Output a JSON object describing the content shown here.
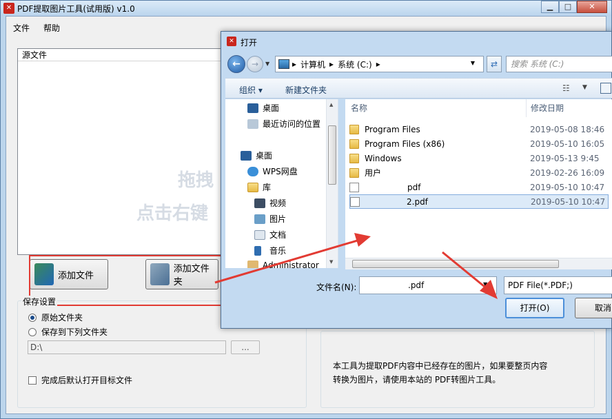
{
  "app": {
    "title": "PDF提取图片工具(试用版) v1.0",
    "icon": "app-logo-icon"
  },
  "menu": {
    "file": "文件",
    "help": "帮助"
  },
  "source_list": {
    "header": "源文件",
    "watermark_line1": "拖拽",
    "watermark_line2": "点击右键"
  },
  "buttons": {
    "add_file": "添加文件",
    "add_folder": "添加文件夹"
  },
  "save_settings": {
    "legend": "保存设置",
    "option_original": "原始文件夹",
    "option_custom": "保存到下列文件夹",
    "path": "D:\\",
    "browse": "...",
    "open_after": "完成后默认打开目标文件"
  },
  "info": {
    "line1": "本工具为提取PDF内容中已经存在的图片，如果要整页内容",
    "line2": "转换为图片，请使用本站的 PDF转图片工具。"
  },
  "dialog": {
    "title": "打开",
    "breadcrumb": [
      "计算机",
      "系统 (C:)"
    ],
    "search_placeholder": "搜索 系统 (C:)",
    "toolbar": {
      "organize": "组织 ▾",
      "new_folder": "新建文件夹"
    },
    "nav": [
      "桌面",
      "最近访问的位置",
      "桌面",
      "WPS网盘",
      "库",
      "视频",
      "图片",
      "文档",
      "音乐",
      "Administrator"
    ],
    "columns": {
      "name": "名称",
      "modified": "修改日期"
    },
    "files": [
      {
        "name": "Program Files",
        "date": "2019-05-08 18:46",
        "kind": "folder"
      },
      {
        "name": "Program Files (x86)",
        "date": "2019-05-10 16:05",
        "kind": "folder"
      },
      {
        "name": "Windows",
        "date": "2019-05-13 9:45",
        "kind": "folder"
      },
      {
        "name": "用户",
        "date": "2019-02-26 16:09",
        "kind": "folder"
      },
      {
        "name": "pdf",
        "date": "2019-05-10 10:47",
        "kind": "file"
      },
      {
        "name": "2.pdf",
        "date": "2019-05-10 10:47",
        "kind": "file",
        "selected": true
      }
    ],
    "filename_label": "文件名(N):",
    "filename_value": ".pdf",
    "filetype": "PDF File(*.PDF;)",
    "open_button": "打开(O)",
    "cancel_button": "取消"
  },
  "colors": {
    "accent": "#e23b33",
    "selection": "#dceaf8"
  }
}
